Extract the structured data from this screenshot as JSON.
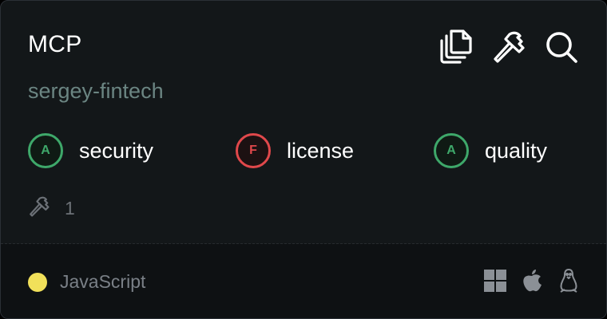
{
  "server": {
    "title": "MCP",
    "owner": "sergey-fintech"
  },
  "actions": [
    {
      "icon": "copy-icon"
    },
    {
      "icon": "hammer-icon"
    },
    {
      "icon": "search-icon"
    }
  ],
  "grades": {
    "security": {
      "grade": "A",
      "label": "security",
      "status": "pass"
    },
    "license": {
      "grade": "F",
      "label": "license",
      "status": "fail"
    },
    "quality": {
      "grade": "A",
      "label": "quality",
      "status": "pass"
    }
  },
  "tools": {
    "icon": "hammer-icon",
    "count": "1"
  },
  "footer": {
    "language": "JavaScript",
    "language_color": "#f1e05a",
    "platforms": [
      "windows-icon",
      "apple-icon",
      "linux-icon"
    ]
  },
  "colors": {
    "pass": "#3ea86a",
    "fail": "#e0484b",
    "owner_text": "#6b8582",
    "background": "#131719"
  }
}
